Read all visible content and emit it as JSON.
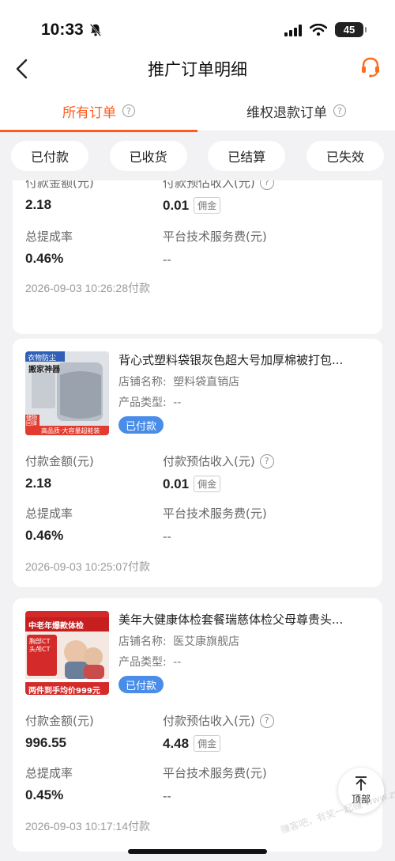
{
  "status_bar": {
    "time": "10:33",
    "battery": "45"
  },
  "nav": {
    "title": "推广订单明细"
  },
  "tabs": [
    {
      "label": "所有订单",
      "active": true
    },
    {
      "label": "维权退款订单",
      "active": false
    }
  ],
  "filters": [
    "已付款",
    "已收货",
    "已结算",
    "已失效"
  ],
  "labels": {
    "pay_amount": "付款金额(元)",
    "est_income": "付款预估收入(元)",
    "commission_rate": "总提成率",
    "service_fee": "平台技术服务费(元)",
    "commission_tag": "佣金",
    "shop_prefix": "店铺名称:",
    "type_prefix": "产品类型:",
    "help_glyph": "?"
  },
  "orders": [
    {
      "pay_amount": "2.18",
      "est_income": "0.01",
      "rate": "0.46%",
      "fee": "--",
      "time": "2026-09-03 10:26:28付款"
    },
    {
      "title": "背心式塑料袋银灰色超大号加厚棉被打包...",
      "shop": "塑料袋直销店",
      "type": "--",
      "status": "已付款",
      "image_text": {
        "top": "衣物防尘",
        "sub": "搬家神器",
        "side": "储物\n回弹",
        "bottom": "高品质·大容量超能装"
      },
      "pay_amount": "2.18",
      "est_income": "0.01",
      "rate": "0.46%",
      "fee": "--",
      "time": "2026-09-03 10:25:07付款"
    },
    {
      "title": "美年大健康体检套餐瑞慈体检父母尊贵头...",
      "shop": "医艾康旗舰店",
      "type": "--",
      "status": "已付款",
      "image_text": {
        "top": "中老年爆款体检",
        "items": "胸部CT\n头颅CT",
        "bottom": "两件到手均价999元"
      },
      "pay_amount": "996.55",
      "est_income": "4.48",
      "rate": "0.45%",
      "fee": "--",
      "time": "2026-09-03 10:17:14付款"
    }
  ],
  "top_button": {
    "label": "顶部"
  },
  "watermark": "赚客吧，有奖一起赚 www.zuanke8.com",
  "colors": {
    "accent": "#ff5a1f",
    "badge": "#4a8de8"
  }
}
